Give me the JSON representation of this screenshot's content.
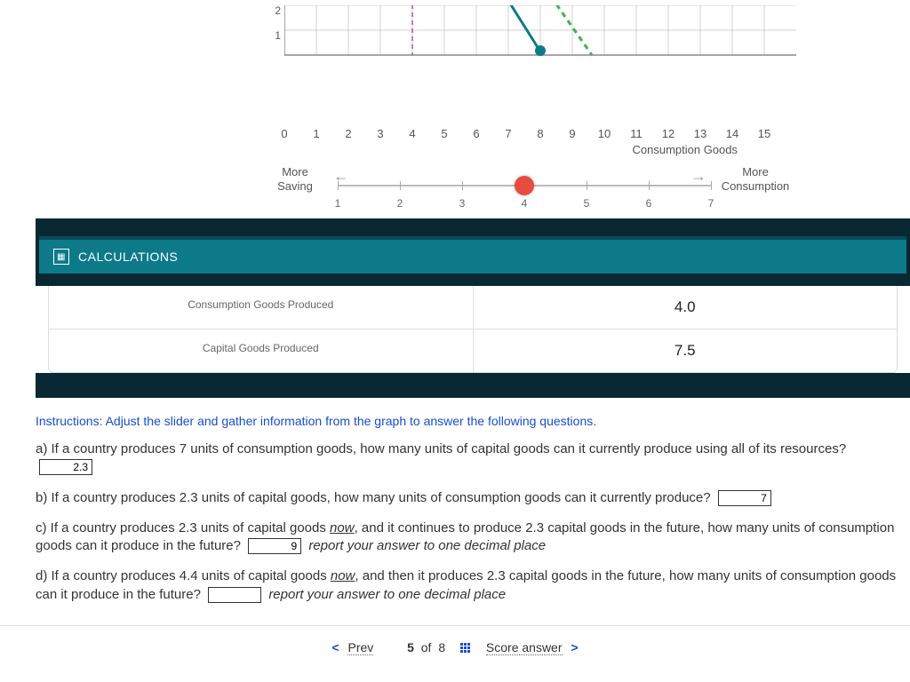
{
  "chart_data": {
    "type": "line",
    "xlabel": "Consumption Goods",
    "ylabel": "",
    "x_ticks": [
      0,
      1,
      2,
      3,
      4,
      5,
      6,
      7,
      8,
      9,
      10,
      11,
      12,
      13,
      14,
      15
    ],
    "y_ticks_visible": [
      2,
      1
    ],
    "xlim": [
      0,
      15
    ],
    "ylim": [
      0,
      2.5
    ],
    "series": [
      {
        "name": "current_ppf_segment",
        "color": "teal",
        "points": [
          [
            6.9,
            2.5
          ],
          [
            8,
            0
          ]
        ]
      },
      {
        "name": "future_ppf_segment",
        "color": "green_dashed",
        "points": [
          [
            8.3,
            2.5
          ],
          [
            9.6,
            0
          ]
        ]
      }
    ],
    "vertical_guide_x": 4,
    "selected_point": {
      "x": 8,
      "y": 0.2
    }
  },
  "slider": {
    "left_top": "More",
    "left_bottom": "Saving",
    "right_top": "More",
    "right_bottom": "Consumption",
    "ticks": [
      "1",
      "2",
      "3",
      "4",
      "5",
      "6",
      "7"
    ],
    "value_index": 3
  },
  "calculations": {
    "header": "CALCULATIONS",
    "rows": [
      {
        "label": "Consumption Goods Produced",
        "value": "4.0"
      },
      {
        "label": "Capital Goods Produced",
        "value": "7.5"
      }
    ]
  },
  "instructions": "Instructions: Adjust the slider and gather information from the graph to answer the following questions.",
  "questions": {
    "a_pre": "a) If a country produces 7 units of consumption goods, how many units of capital goods can it currently produce using all of its resources?",
    "a_ans": "2.3",
    "b_pre": "b) If a country produces 2.3 units of capital goods, how many units of consumption goods can it currently produce?",
    "b_ans": "7",
    "c_pre": "c) If a country produces 2.3 units of capital goods ",
    "c_now": "now",
    "c_mid": ", and it continues to produce 2.3 capital goods in the future, how many units of consumption goods can it produce in the future?",
    "c_ans": "9",
    "c_note": "report your answer to one decimal place",
    "d_pre": "d) If a country produces 4.4 units of capital goods ",
    "d_now": "now",
    "d_mid": ", and then it produces 2.3 capital goods in the future, how many units of consumption goods can it produce in the future?",
    "d_ans": "",
    "d_note": "report your answer to one decimal place"
  },
  "footer": {
    "prev": "Prev",
    "pos_cur": "5",
    "pos_of": "of",
    "pos_total": "8",
    "score": "Score answer"
  }
}
